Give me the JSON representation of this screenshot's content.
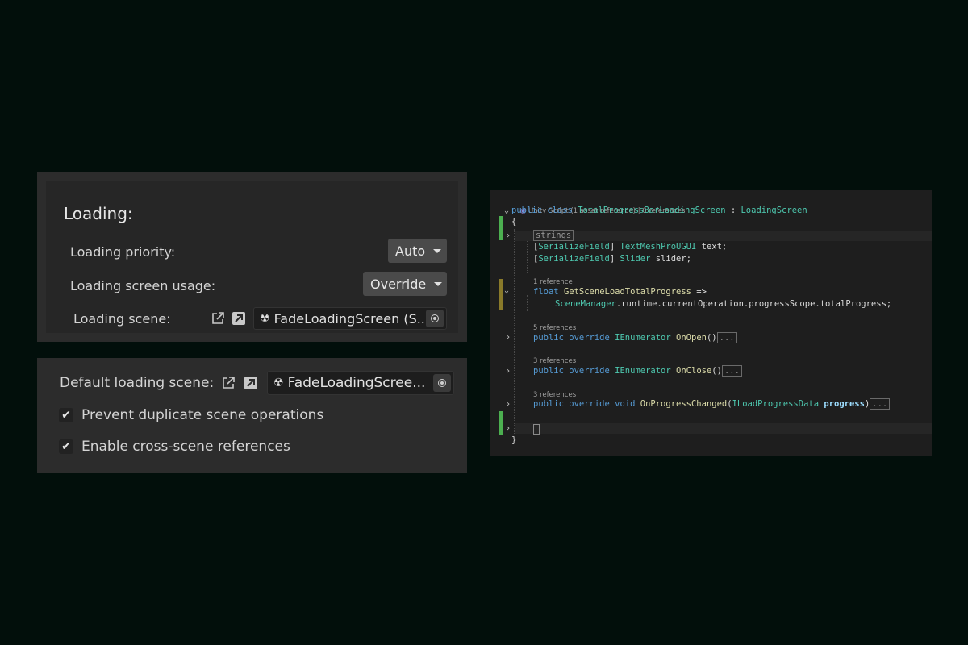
{
  "loading_panel": {
    "title": "Loading:",
    "priority_label": "Loading priority:",
    "priority_value": "Auto",
    "usage_label": "Loading screen usage:",
    "usage_value": "Override",
    "scene_label": "Loading scene:",
    "scene_value": "FadeLoadingScreen (S..."
  },
  "defaults_panel": {
    "default_scene_label": "Default loading scene:",
    "default_scene_value": "FadeLoadingScree...",
    "prevent_duplicate_label": "Prevent duplicate scene operations",
    "prevent_duplicate_checked": true,
    "cross_scene_label": "Enable cross-scene references",
    "cross_scene_checked": true
  },
  "code": {
    "header_lens": "Unity Script (1 asset reference) | 0 references",
    "class_kw": "public class",
    "class_name": "TotalProgressBarLoadingScreen",
    "class_sep": " : ",
    "base_class": "LoadingScreen",
    "open_brace": "{",
    "region": "strings",
    "field1_attr": "SerializeField",
    "field1_type": "TextMeshProUGUI",
    "field1_name": " text;",
    "field2_attr": "SerializeField",
    "field2_type": "Slider",
    "field2_name": " slider;",
    "lens1": "1 reference",
    "method1_kw": "float",
    "method1_name": "GetSceneLoadTotalProgress",
    "method1_arrow": " =>",
    "method1_body_type": "SceneManager",
    "method1_body_rest": ".runtime.currentOperation.progressScope.totalProgress;",
    "lens2": "5 references",
    "method2_kw": "public override",
    "method2_type": "IEnumerator",
    "method2_name": "OnOpen",
    "method2_parens": "()",
    "lens3": "3 references",
    "method3_kw": "public override",
    "method3_type": "IEnumerator",
    "method3_name": "OnClose",
    "method3_parens": "()",
    "lens4": "3 references",
    "method4_kw": "public override void",
    "method4_name": "OnProgressChanged",
    "method4_ptype": "ILoadProgressData",
    "method4_pname": "progress",
    "ellipsis": "...",
    "close_brace": "}"
  },
  "colors": {
    "background": "#020f0b",
    "panel": "#2c2c2c",
    "code_bg": "#1e1e1e",
    "keyword": "#569cd6",
    "type": "#4ec9b0",
    "method": "#dcdcaa",
    "param": "#9cdcfe",
    "change_green": "#4caf50",
    "change_yellow": "#8a7a2a"
  },
  "icons": [
    "external-link-icon",
    "ping-arrow-icon",
    "scene-asset-icon",
    "object-picker-icon",
    "checkmark-icon",
    "fold-chevron-icon"
  ]
}
